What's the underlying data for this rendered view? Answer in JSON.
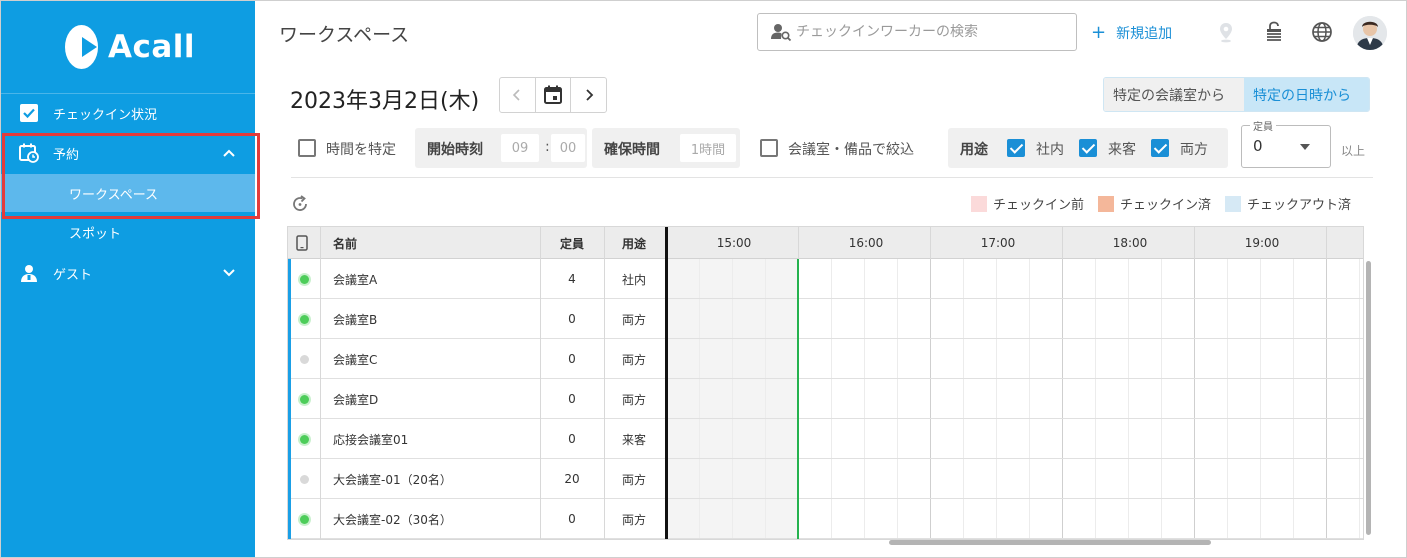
{
  "app": {
    "name": "Acall"
  },
  "sidebar": {
    "items": [
      {
        "label": "チェックイン状況",
        "icon": "checkbox-icon"
      },
      {
        "label": "予約",
        "icon": "calendar-clock-icon",
        "expanded": true,
        "children": [
          {
            "label": "ワークスペース",
            "active": true
          },
          {
            "label": "スポット"
          }
        ]
      },
      {
        "label": "ゲスト",
        "icon": "person-icon",
        "expanded": false
      }
    ]
  },
  "header": {
    "title": "ワークスペース",
    "search_placeholder": "チェックインワーカーの検索",
    "add_label": "新規追加",
    "add_plus": "+"
  },
  "date_bar": {
    "date": "2023年3月2日(木)",
    "mode_options": [
      "特定の会議室から",
      "特定の日時から"
    ],
    "active_mode": "特定の日時から"
  },
  "filters": {
    "time_specify": {
      "label": "時間を特定",
      "checked": false
    },
    "start_time": {
      "label": "開始時刻",
      "hour": "09",
      "separator": ":",
      "minute": "00"
    },
    "duration": {
      "label": "確保時間",
      "value": "1時間"
    },
    "room_equipment": {
      "label": "会議室・備品で絞込",
      "checked": false
    },
    "usage": {
      "label": "用途",
      "options": [
        {
          "label": "社内",
          "checked": true
        },
        {
          "label": "来客",
          "checked": true
        },
        {
          "label": "両方",
          "checked": true
        }
      ]
    },
    "capacity": {
      "label": "定員",
      "value": "0",
      "suffix": "以上"
    }
  },
  "legend": [
    {
      "label": "チェックイン前",
      "color": "#fbdada"
    },
    {
      "label": "チェックイン済",
      "color": "#f4b79a"
    },
    {
      "label": "チェックアウト済",
      "color": "#d6e9f5"
    }
  ],
  "table": {
    "columns": {
      "name": "名前",
      "capacity": "定員",
      "usage": "用途"
    },
    "hours": [
      "15:00",
      "16:00",
      "17:00",
      "18:00",
      "19:00"
    ],
    "rows": [
      {
        "name": "会議室A",
        "capacity": "4",
        "usage": "社内",
        "online": true
      },
      {
        "name": "会議室B",
        "capacity": "0",
        "usage": "両方",
        "online": true
      },
      {
        "name": "会議室C",
        "capacity": "0",
        "usage": "両方",
        "online": false
      },
      {
        "name": "会議室D",
        "capacity": "0",
        "usage": "両方",
        "online": true
      },
      {
        "name": "応接会議室01",
        "capacity": "0",
        "usage": "来客",
        "online": true
      },
      {
        "name": "大会議室-01（20名）",
        "capacity": "20",
        "usage": "両方",
        "online": false
      },
      {
        "name": "大会議室-02（30名）",
        "capacity": "0",
        "usage": "両方",
        "online": true
      }
    ]
  },
  "colors": {
    "brand": "#0e9de2",
    "accent": "#1a8fd6",
    "highlight": "#e33b3b",
    "online": "#4dcd5a"
  }
}
